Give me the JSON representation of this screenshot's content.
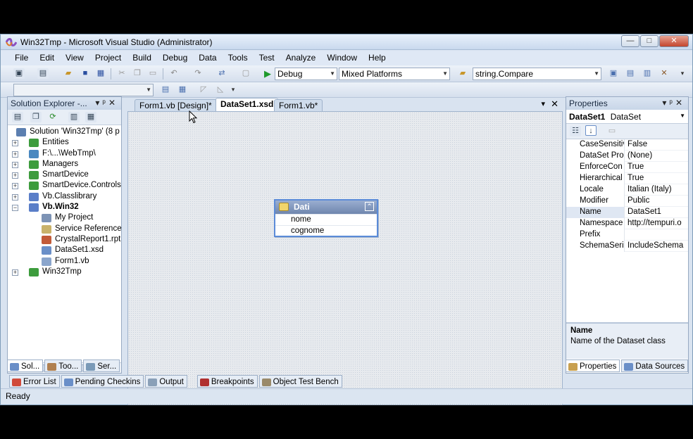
{
  "window": {
    "title": "Win32Tmp - Microsoft Visual Studio (Administrator)",
    "controls": [
      "—",
      "□",
      "✕"
    ]
  },
  "menu": [
    "File",
    "Edit",
    "View",
    "Project",
    "Build",
    "Debug",
    "Data",
    "Tools",
    "Test",
    "Analyze",
    "Window",
    "Help"
  ],
  "toolbar": {
    "config": "Debug",
    "platform": "Mixed Platforms",
    "find": "string.Compare"
  },
  "solution_explorer": {
    "title": "Solution Explorer -...",
    "items": [
      {
        "label": "Solution 'Win32Tmp' (8 p",
        "bold": false
      },
      {
        "label": "Entities",
        "bold": false
      },
      {
        "label": "F:\\...\\WebTmp\\",
        "bold": false
      },
      {
        "label": "Managers",
        "bold": false
      },
      {
        "label": "SmartDevice",
        "bold": false
      },
      {
        "label": "SmartDevice.Controls",
        "bold": false
      },
      {
        "label": "Vb.Classlibrary",
        "bold": false
      },
      {
        "label": "Vb.Win32",
        "bold": true
      },
      {
        "label": "My Project",
        "bold": false
      },
      {
        "label": "Service References",
        "bold": false
      },
      {
        "label": "CrystalReport1.rpt",
        "bold": false
      },
      {
        "label": "DataSet1.xsd",
        "bold": false
      },
      {
        "label": "Form1.vb",
        "bold": false
      },
      {
        "label": "Win32Tmp",
        "bold": false
      }
    ],
    "tabs": [
      "Sol...",
      "Too...",
      "Ser..."
    ]
  },
  "documents": {
    "tabs": [
      "Form1.vb [Design]*",
      "DataSet1.xsd",
      "Form1.vb*"
    ],
    "active": 1
  },
  "dataset": {
    "table_name": "Dati",
    "columns": [
      "nome",
      "cognome"
    ]
  },
  "properties": {
    "title": "Properties",
    "object_name": "DataSet1",
    "object_type": "DataSet",
    "rows": [
      {
        "name": "CaseSensitiv",
        "value": "False"
      },
      {
        "name": "DataSet Pro",
        "value": "(None)"
      },
      {
        "name": "EnforceCon",
        "value": "True"
      },
      {
        "name": "Hierarchical",
        "value": "True"
      },
      {
        "name": "Locale",
        "value": "Italian (Italy)"
      },
      {
        "name": "Modifier",
        "value": "Public"
      },
      {
        "name": "Name",
        "value": "DataSet1"
      },
      {
        "name": "Namespace",
        "value": "http://tempuri.o"
      },
      {
        "name": "Prefix",
        "value": ""
      },
      {
        "name": "SchemaSeri",
        "value": "IncludeSchema"
      }
    ],
    "desc_title": "Name",
    "desc_text": "Name of the Dataset class",
    "tabs": [
      "Properties",
      "Data Sources"
    ]
  },
  "bottom_tabs": [
    "Error List",
    "Pending Checkins",
    "Output",
    "Breakpoints",
    "Object Test Bench"
  ],
  "status": "Ready",
  "colors": {
    "accent": "#5b8bd8",
    "chrome": "#d9e3f0"
  }
}
